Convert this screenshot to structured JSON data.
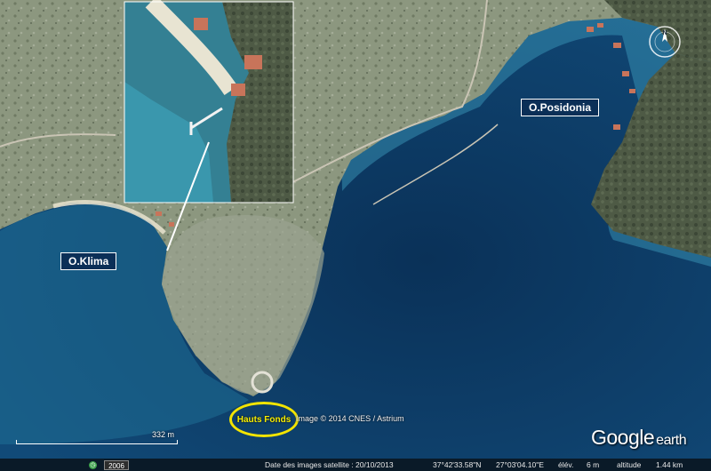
{
  "labels": {
    "klima": "O.Klima",
    "posidonia": "O.Posidonia",
    "shoals": "Hauts Fonds"
  },
  "imagery_credit": "Image © 2014 CNES / Astrium",
  "scale": {
    "value": "332",
    "unit": "m"
  },
  "logo": {
    "google": "Google",
    "earth": "earth"
  },
  "compass": {
    "north": "N"
  },
  "history": {
    "year": "2006"
  },
  "status": {
    "imagery_date_label": "Date des images satellite : 20/10/2013",
    "latitude": "37°42'33.58\"N",
    "longitude": "27°03'04.10\"E",
    "elevation_label": "élév.",
    "elevation_value": "6 m",
    "altitude_label": "altitude",
    "altitude_value": "1.44 km"
  },
  "colors": {
    "deep_water": "#0d3a63",
    "shallow_water": "#4fb3c6",
    "land": "#8e9a82",
    "label_bg": "#0b2f57",
    "shoal_ring": "#f2e400"
  }
}
